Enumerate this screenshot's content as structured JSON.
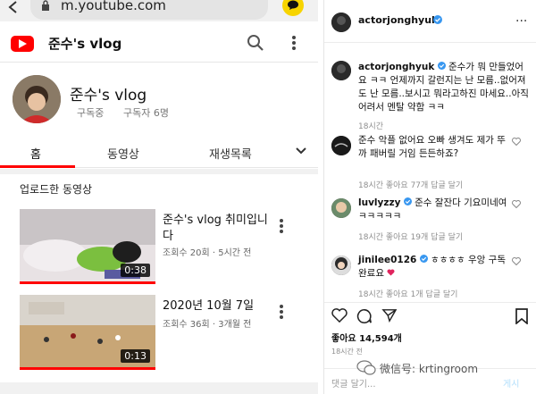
{
  "youtube": {
    "url": "m.youtube.com",
    "channel_title": "준수's vlog",
    "channel_name": "준수's vlog",
    "subscribe_label": "구독중",
    "subscriber_count": "구독자 6명",
    "tabs": [
      {
        "label": "홈",
        "active": true
      },
      {
        "label": "동영상",
        "active": false
      },
      {
        "label": "재생목록",
        "active": false
      }
    ],
    "section_title": "업로드한 동영상",
    "videos": [
      {
        "title": "준수's vlog 취미입니다",
        "meta": "조회수 20회 · 5시간 전",
        "duration": "0:38"
      },
      {
        "title": "2020년 10월 7일",
        "meta": "조회수 36회 · 3개월 전",
        "duration": "0:13"
      }
    ],
    "colors": {
      "brand": "#ff0000",
      "notification_badge": "#f7d400"
    }
  },
  "instagram": {
    "handle": "actorjonghyuk",
    "caption": {
      "user": "actorjonghyuk",
      "text": "준수가 뭐 만들었어요 ㅋㅋ 언제까지 갈런지는 난 모름..없어져도 난 모름..보시고 뭐라고하진 마세요..아직 어려서 멘탈 약함 ㅋㅋ",
      "time": "18시간"
    },
    "comments": [
      {
        "user": "",
        "text": "준수 악플 없어요 오빠 생겨도 제가 뚜까 패버릴 거임 든든하죠?",
        "meta": "18시간   좋아요 77개   답글 달기"
      },
      {
        "user": "luvlyzzy",
        "text": "준수 잘잔다 기요미네여 ㅋㅋㅋㅋㅋ",
        "meta": "18시간   좋아요 19개   답글 달기"
      },
      {
        "user": "jinilee0126",
        "text": "ㅎㅎㅎㅎ 우앙 구독완료요",
        "meta": "18시간   좋아요 1개   답글 달기"
      }
    ],
    "likes": "좋아요 14,594개",
    "post_time": "18시간 전",
    "add_comment_placeholder": "댓글 달기...",
    "post_button": "게시",
    "watermark": "微信号: krtingroom"
  }
}
